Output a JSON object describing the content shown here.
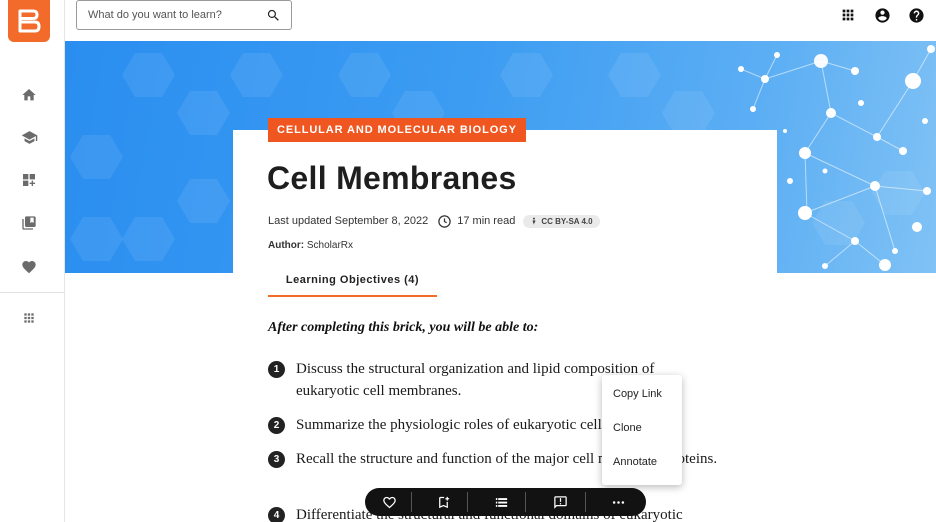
{
  "search": {
    "placeholder": "What do you want to learn?"
  },
  "sidebar": {
    "items": [
      {
        "icon": "home-icon"
      },
      {
        "icon": "graduation-cap-icon"
      },
      {
        "icon": "dashboard-icon"
      },
      {
        "icon": "bookmark-icon"
      },
      {
        "icon": "heart-icon"
      },
      {
        "icon": "apps-grid-icon"
      }
    ]
  },
  "topbar": {
    "icons": [
      "apps-grid-icon",
      "account-icon",
      "help-icon"
    ]
  },
  "colors": {
    "accent": "#f26b2b",
    "tag": "#f0561f",
    "banner": "#2a8ef0",
    "toolbar": "#121212"
  },
  "brick": {
    "subject": "CELLULAR AND MOLECULAR BIOLOGY",
    "title": "Cell Membranes",
    "updated": "Last updated September 8, 2022",
    "read_time": "17 min read",
    "license": "CC BY-SA 4.0",
    "author_label": "Author:",
    "author": "ScholarRx"
  },
  "tabs": [
    {
      "label": "Learning Objectives (4)"
    }
  ],
  "objectives": {
    "intro": "After completing this brick, you will be able to:",
    "items": [
      {
        "number": "1",
        "text": "Discuss the structural organization and lipid composition of eukaryotic cell membranes."
      },
      {
        "number": "2",
        "text": "Summarize the physiologic roles of eukaryotic cell membranes."
      },
      {
        "number": "3",
        "text": "Recall the structure and function of the major cell membrane proteins."
      },
      {
        "number": "4",
        "text": "Differentiate the structural and functional domains of eukaryotic"
      }
    ]
  },
  "toolbar": {
    "icons": [
      "heart-icon",
      "bookmark-add-icon",
      "list-icon",
      "comment-icon",
      "more-icon"
    ]
  },
  "context_menu": {
    "items": [
      {
        "label": "Copy Link"
      },
      {
        "label": "Clone"
      },
      {
        "label": "Annotate"
      }
    ]
  }
}
